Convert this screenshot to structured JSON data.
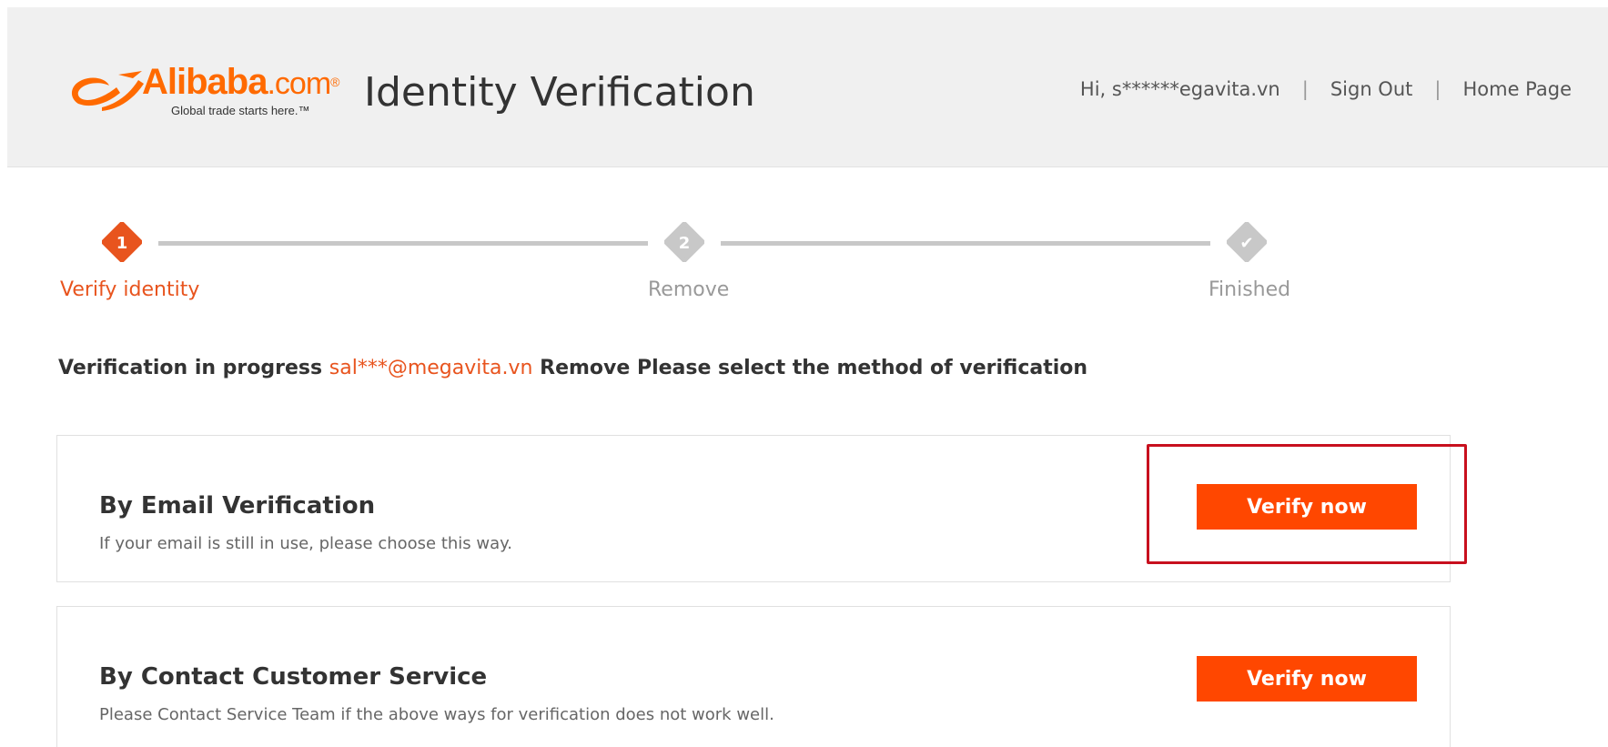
{
  "header": {
    "logo": {
      "word": "Alibaba",
      "dotcom": ".com",
      "registered": "®",
      "tagline": "Global trade starts here.™"
    },
    "title": "Identity Verification",
    "user_greeting": "Hi, s******egavita.vn",
    "separator": "|",
    "sign_out": "Sign Out",
    "home_page": "Home Page"
  },
  "stepper": {
    "steps": [
      {
        "number": "1",
        "label": "Verify identity",
        "state": "active"
      },
      {
        "number": "2",
        "label": "Remove",
        "state": "pending"
      },
      {
        "number": "✔",
        "label": "Finished",
        "state": "pending"
      }
    ]
  },
  "prompt": {
    "prefix": "Verification in progress",
    "email": "sal***@megavita.vn",
    "suffix": "Remove Please select the method of verification"
  },
  "methods": [
    {
      "title": "By Email Verification",
      "description": "If your email is still in use, please choose this way.",
      "button": "Verify now"
    },
    {
      "title": "By Contact Customer Service",
      "description": "Please Contact Service Team if the above ways for verification does not work well.",
      "button": "Verify now"
    }
  ],
  "colors": {
    "accent": "#ff4700",
    "active_step": "#e8541e",
    "inactive_step": "#c8c8c8",
    "highlight": "#c8101e",
    "header_bg": "#f0f0f0"
  }
}
